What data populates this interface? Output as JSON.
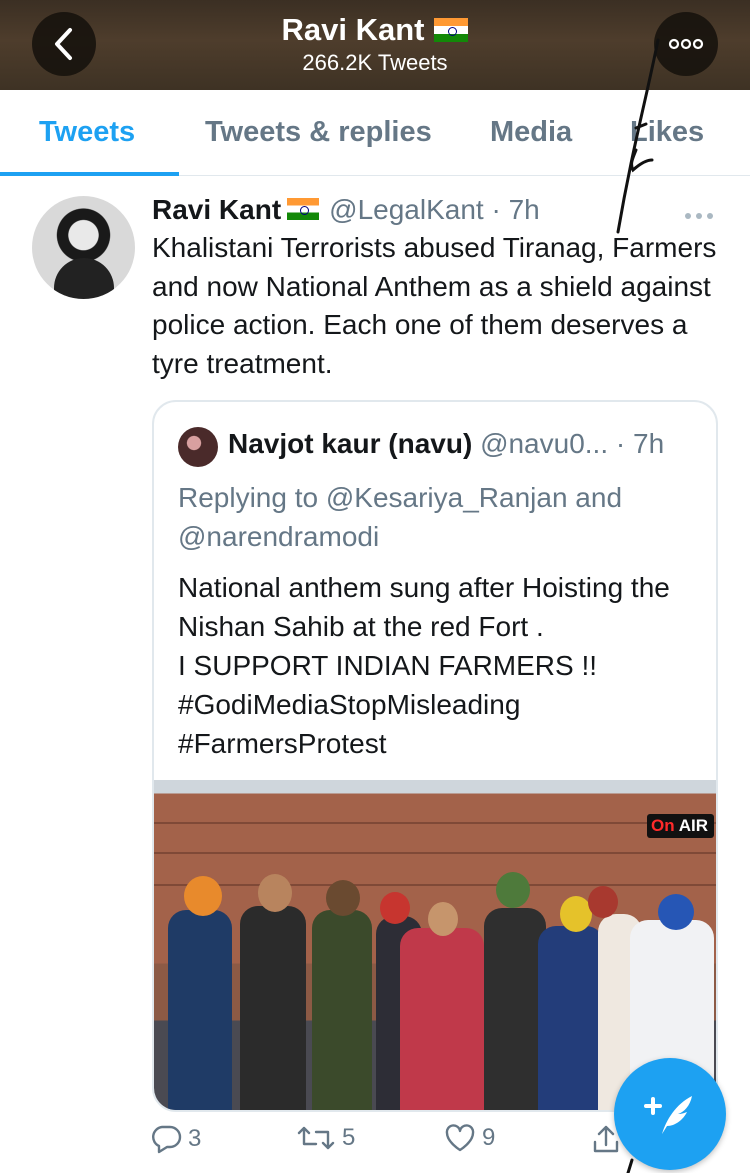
{
  "header": {
    "name": "Ravi Kant",
    "tweet_count": "266.2K Tweets"
  },
  "tabs": [
    {
      "label": "Tweets",
      "active": true
    },
    {
      "label": "Tweets & replies",
      "active": false
    },
    {
      "label": "Media",
      "active": false
    },
    {
      "label": "Likes",
      "active": false
    }
  ],
  "tweet": {
    "author": "Ravi Kant",
    "handle_time": "@LegalKant · 7h",
    "text": "Khalistani Terrorists abused Tiranag, Farmers and now National Anthem as a shield against police action. Each one of them deserves a tyre treatment.",
    "quote": {
      "author": "Navjot kaur (navu)",
      "handle_time": "@navu0... · 7h",
      "replying": "Replying to @Kesariya_Ranjan and @narendramodi",
      "text": "National anthem sung after Hoisting the Nishan Sahib at the red Fort .\n I SUPPORT INDIAN FARMERS !!\n#GodiMediaStopMisleading\n#FarmersProtest",
      "media_badge_on": "On",
      "media_badge_air": "AIR"
    },
    "actions": {
      "replies": "3",
      "retweets": "5",
      "likes": "9"
    }
  },
  "icons": {
    "back": "chevron-left-icon",
    "more": "more-horizontal-icon",
    "caret": "caret-icon",
    "reply": "reply-icon",
    "retweet": "retweet-icon",
    "like": "heart-icon",
    "share": "share-icon",
    "compose": "compose-icon"
  },
  "colors": {
    "accent": "#1da1f2",
    "muted": "#657786",
    "header_bg": "#4e3d2c"
  }
}
